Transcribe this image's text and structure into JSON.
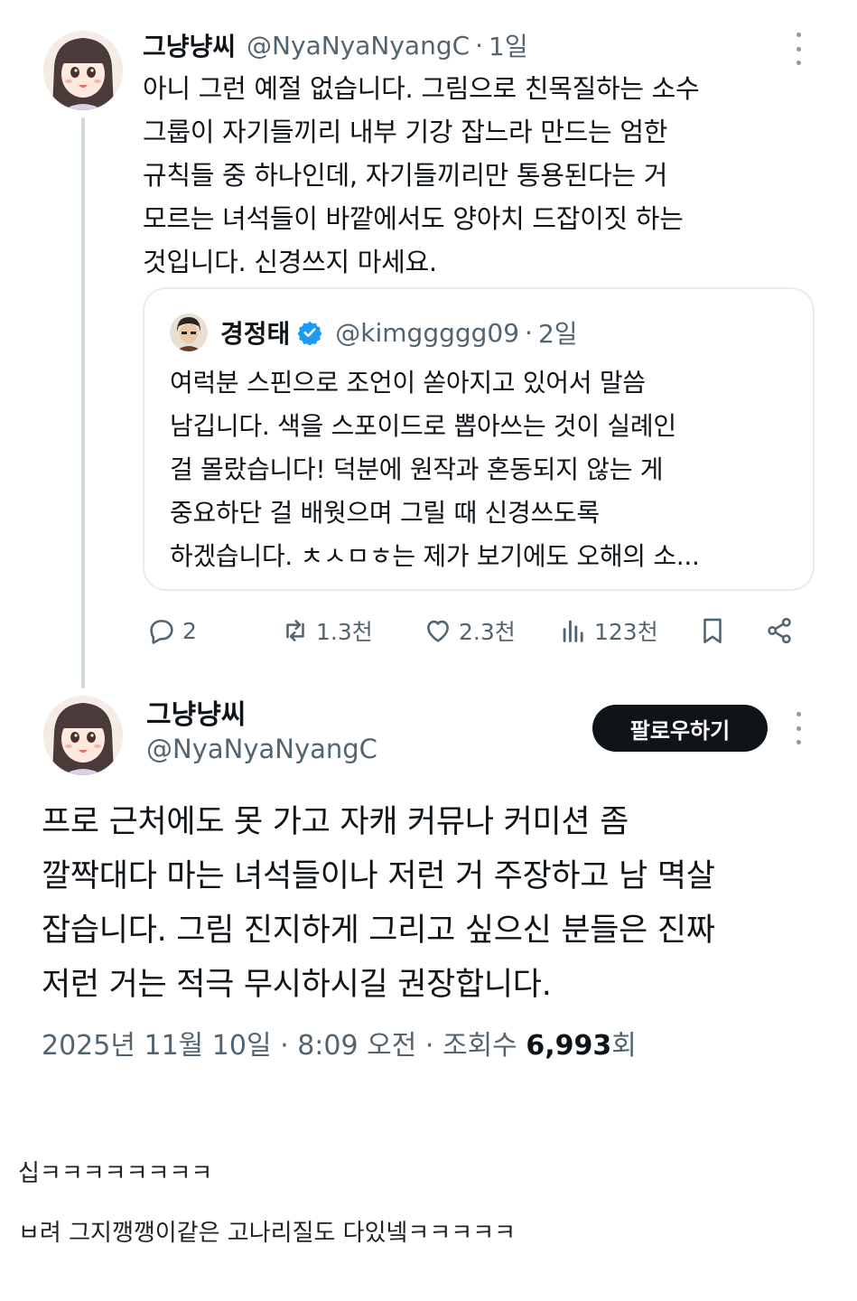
{
  "tweet1": {
    "name": "그냥냥씨",
    "handle": "@NyaNyaNyangC",
    "separator": "·",
    "time": "1일",
    "lines": [
      "아니 그런 예절 없습니다. 그림으로 친목질하는 소수",
      "그룹이 자기들끼리 내부 기강 잡느라 만드는 엄한",
      "규칙들 중 하나인데, 자기들끼리만 통용된다는 거",
      "모르는 녀석들이 바깥에서도 양아치 드잡이짓 하는",
      "것입니다. 신경쓰지 마세요."
    ],
    "quote": {
      "name": "경정태",
      "handle": "@kimggggg09",
      "separator": "·",
      "time": "2일",
      "lines": [
        "여럭분 스핀으로 조언이 쏟아지고 있어서 말씀",
        "남깁니다. 색을 스포이드로 뽑아쓰는 것이 실례인",
        "걸 몰랐습니다! 덕분에 원작과 혼동되지 않는 게",
        "중요하단 걸 배웟으며 그릴 때 신경쓰도록",
        "하겠습니다. ㅊㅅㅁㅎ는 제가 보기에도 오해의 소..."
      ]
    },
    "actions": {
      "replies": "2",
      "retweets": "1.3천",
      "likes": "2.3천",
      "views": "123천"
    }
  },
  "tweet2": {
    "name": "그냥냥씨",
    "handle": "@NyaNyaNyangC",
    "follow_label": "팔로우하기",
    "lines": [
      "프로 근처에도 못 가고 자캐 커뮤나 커미션 좀",
      "깔짝대다 마는 녀석들이나 저런 거 주장하고 남 멱살",
      "잡습니다. 그림 진지하게 그리고 싶으신 분들은 진짜",
      "저런 거는 적극 무시하시길 권장합니다."
    ],
    "meta": {
      "date": "2025년 11월 10일",
      "time": "8:09 오전",
      "views_label": "조회수",
      "views": "6,993",
      "views_suffix": "회",
      "separator": "·"
    }
  },
  "comments": [
    "십ㅋㅋㅋㅋㅋㅋㅋㅋ",
    "ㅂ려 그지깽깽이같은 고나리질도 다있넼ㅋㅋㅋㅋㅋ"
  ],
  "colors": {
    "text": "#0f1419",
    "secondary": "#536471",
    "verified": "#1d9bf0",
    "border": "#e7ecf0"
  }
}
